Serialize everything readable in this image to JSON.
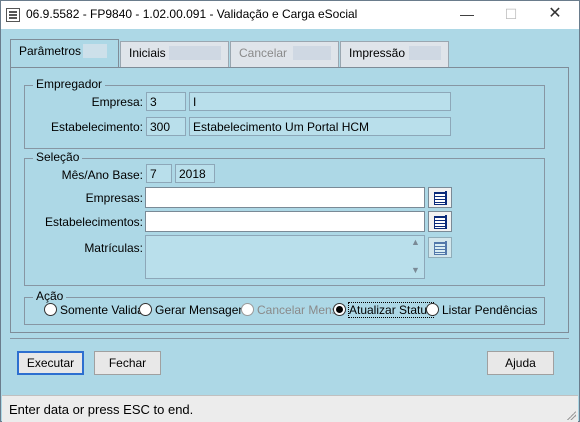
{
  "window": {
    "title": "06.9.5582 - FP9840 - 1.02.00.091 - Validação e Carga eSocial",
    "minimize_glyph": "—",
    "maximize_glyph": "☐",
    "close_glyph": "✕"
  },
  "tabs": [
    {
      "label": "Parâmetros",
      "active": true,
      "enabled": true
    },
    {
      "label": "Iniciais",
      "active": false,
      "enabled": true
    },
    {
      "label": "Cancelar",
      "active": false,
      "enabled": false
    },
    {
      "label": "Impressão",
      "active": false,
      "enabled": true
    }
  ],
  "empregador": {
    "title": "Empregador",
    "empresa_label": "Empresa:",
    "empresa_code": "3",
    "empresa_name": "I",
    "estab_label": "Estabelecimento:",
    "estab_code": "300",
    "estab_name": "Estabelecimento Um Portal HCM"
  },
  "selecao": {
    "title": "Seleção",
    "mes_ano_label": "Mês/Ano Base:",
    "mes": "7",
    "ano": "2018",
    "empresas_label": "Empresas:",
    "empresas_value": "",
    "estabelecimentos_label": "Estabelecimentos:",
    "estabelecimentos_value": "",
    "matriculas_label": "Matrículas:",
    "matriculas_value": ""
  },
  "acao": {
    "title": "Ação",
    "options": [
      {
        "label": "Somente Validar",
        "checked": false,
        "enabled": true
      },
      {
        "label": "Gerar Mensagens",
        "checked": false,
        "enabled": true
      },
      {
        "label": "Cancelar Mens.",
        "checked": false,
        "enabled": false
      },
      {
        "label": "Atualizar Status",
        "checked": true,
        "enabled": true
      },
      {
        "label": "Listar Pendências",
        "checked": false,
        "enabled": true
      }
    ]
  },
  "buttons": {
    "executar": "Executar",
    "fechar": "Fechar",
    "ajuda": "Ajuda"
  },
  "status_bar": {
    "text": "Enter data or press ESC to end."
  },
  "colors": {
    "background": "#add8e6",
    "default_button_border": "#2d6fd0"
  }
}
